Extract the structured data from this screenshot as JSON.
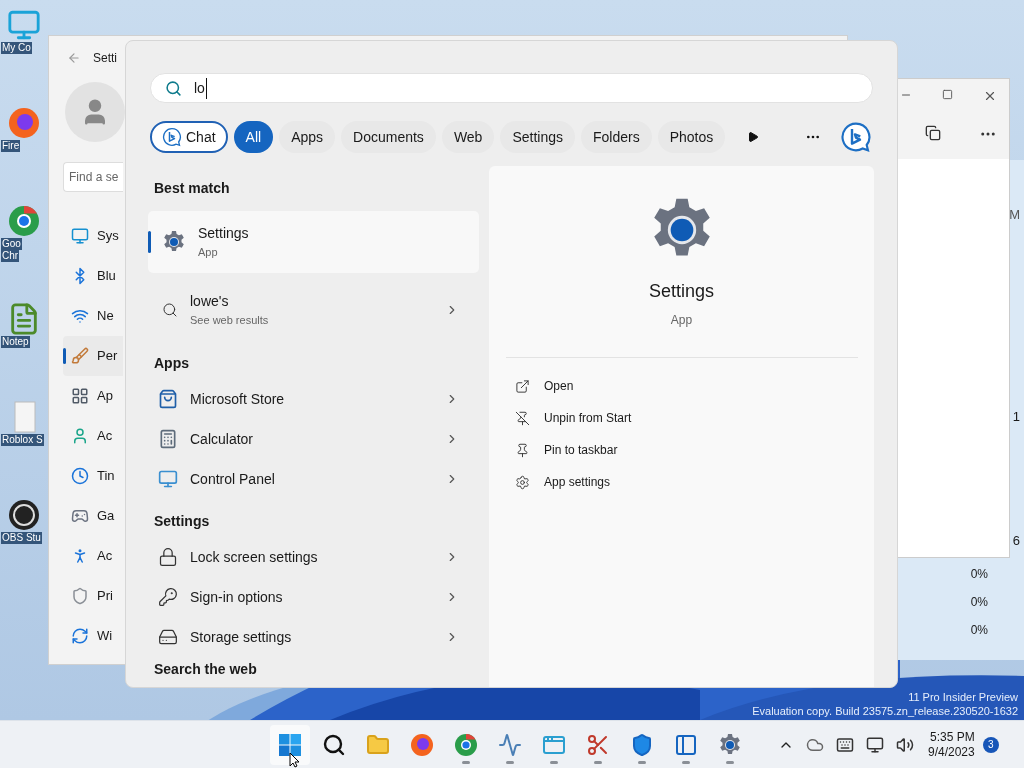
{
  "desktop_icons": [
    {
      "kind": "monitor",
      "lines": [
        "My Co"
      ]
    },
    {
      "kind": "firefox",
      "lines": [
        "Fire"
      ]
    },
    {
      "kind": "chrome",
      "lines": [
        "Goo",
        "Chr"
      ]
    },
    {
      "kind": "notepad",
      "lines": [
        "Notep"
      ]
    },
    {
      "kind": "document",
      "lines": [
        "Roblox S"
      ]
    },
    {
      "kind": "obs",
      "lines": [
        "OBS Stu"
      ]
    }
  ],
  "settings_window": {
    "title": "Setti",
    "search_placeholder": "Find a se",
    "nav": [
      {
        "kind": "system",
        "label": "Sys",
        "selected": false
      },
      {
        "kind": "bluetooth",
        "label": "Blu",
        "selected": false
      },
      {
        "kind": "network",
        "label": "Ne",
        "selected": false
      },
      {
        "kind": "brush",
        "label": "Per",
        "selected": true
      },
      {
        "kind": "apps",
        "label": "Ap",
        "selected": false
      },
      {
        "kind": "account",
        "label": "Ac",
        "selected": false
      },
      {
        "kind": "time",
        "label": "Tin",
        "selected": false
      },
      {
        "kind": "gaming",
        "label": "Ga",
        "selected": false
      },
      {
        "kind": "accessibility",
        "label": "Ac",
        "selected": false
      },
      {
        "kind": "privacy",
        "label": "Pri",
        "selected": false
      },
      {
        "kind": "update",
        "label": "Wi",
        "selected": false
      }
    ]
  },
  "background_window": {
    "edge_texts": [
      "M",
      "1",
      "6"
    ],
    "percent_cells": [
      "0%",
      "0%",
      "0%"
    ]
  },
  "watermark": [
    "11 Pro Insider Preview",
    "Evaluation copy. Build 23575.zn_release.230520-1632"
  ],
  "search": {
    "query": "lo",
    "filters": [
      {
        "kind": "chat",
        "label": "Chat",
        "selected": false
      },
      {
        "kind": "plain",
        "label": "All",
        "selected": true
      },
      {
        "kind": "plain",
        "label": "Apps",
        "selected": false
      },
      {
        "kind": "plain",
        "label": "Documents",
        "selected": false
      },
      {
        "kind": "plain",
        "label": "Web",
        "selected": false
      },
      {
        "kind": "plain",
        "label": "Settings",
        "selected": false
      },
      {
        "kind": "plain",
        "label": "Folders",
        "selected": false
      },
      {
        "kind": "plain",
        "label": "Photos",
        "selected": false
      }
    ]
  },
  "results": {
    "best_match_heading": "Best match",
    "best_match": {
      "title": "Settings",
      "subtitle": "App",
      "selected": true
    },
    "web_suggestion": {
      "title": "lowe's",
      "subtitle": "See web results"
    },
    "groups": [
      {
        "heading": "Apps",
        "items": [
          {
            "kind": "store",
            "label": "Microsoft Store"
          },
          {
            "kind": "calculator",
            "label": "Calculator"
          },
          {
            "kind": "control_panel",
            "label": "Control Panel"
          }
        ]
      },
      {
        "heading": "Settings",
        "items": [
          {
            "kind": "lock",
            "label": "Lock screen settings"
          },
          {
            "kind": "key",
            "label": "Sign-in options"
          },
          {
            "kind": "storage",
            "label": "Storage settings"
          }
        ]
      }
    ],
    "footer_heading": "Search the web"
  },
  "preview": {
    "title": "Settings",
    "subtitle": "App",
    "actions": [
      {
        "kind": "open",
        "label": "Open"
      },
      {
        "kind": "unpin",
        "label": "Unpin from Start"
      },
      {
        "kind": "pin",
        "label": "Pin to taskbar"
      },
      {
        "kind": "gear",
        "label": "App settings"
      }
    ]
  },
  "taskbar": {
    "apps": [
      {
        "kind": "start",
        "running": false
      },
      {
        "kind": "search",
        "running": false
      },
      {
        "kind": "explorer",
        "running": false
      },
      {
        "kind": "firefox",
        "running": false
      },
      {
        "kind": "chrome",
        "running": true
      },
      {
        "kind": "taskmanager",
        "running": true
      },
      {
        "kind": "window",
        "running": true
      },
      {
        "kind": "snip",
        "running": true
      },
      {
        "kind": "defender",
        "running": true
      },
      {
        "kind": "sandbox",
        "running": true
      },
      {
        "kind": "settings",
        "running": true
      }
    ],
    "time": "5:35 PM",
    "date": "9/4/2023",
    "notifications": "3"
  }
}
